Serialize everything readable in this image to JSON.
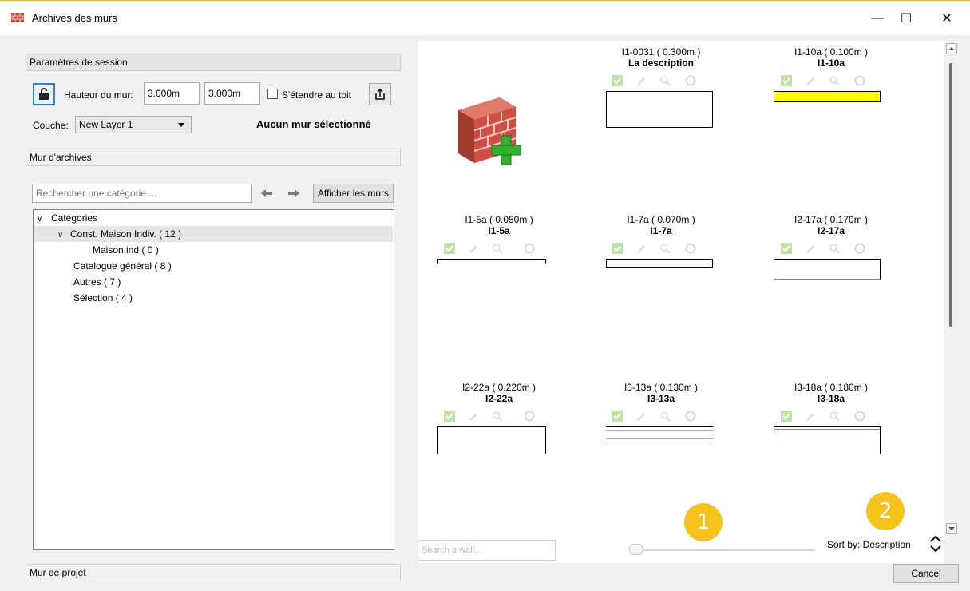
{
  "window": {
    "title": "Archives des murs",
    "minimize": "—",
    "maximize": "☐",
    "close": "✕"
  },
  "session": {
    "header": "Paramètres de session",
    "wall_height_label": "Hauteur du mur:",
    "height1": "3.000m",
    "height2": "3.000m",
    "extend_roof_label": "S'étendre au toit",
    "layer_label": "Couche:",
    "layer_value": "New Layer 1",
    "no_selection": "Aucun mur sélectionné"
  },
  "archive": {
    "header": "Mur d'archives",
    "search_placeholder": "Rechercher une catégorie ...",
    "show_walls": "Afficher les murs",
    "tree": {
      "root": "Catégories",
      "items": [
        {
          "label": "Const. Maison Indiv. ( 12 )"
        },
        {
          "label": "Maison ind ( 0 )"
        },
        {
          "label": "Catalogue général ( 8 )"
        },
        {
          "label": "Autres ( 7 )"
        },
        {
          "label": "Sélection ( 4 )"
        }
      ]
    }
  },
  "project": {
    "header": "Mur de projet"
  },
  "walls": [
    {
      "title": "I1-0031 ( 0.300m )",
      "sub": "La description",
      "preview": "empty-box"
    },
    {
      "title": "I1-10a ( 0.100m )",
      "sub": "I1-10a",
      "preview": "yellow"
    },
    {
      "title": "I1-5a ( 0.050m )",
      "sub": "I1-5a",
      "preview": "thin"
    },
    {
      "title": "I1-7a ( 0.070m )",
      "sub": "I1-7a",
      "preview": "double"
    },
    {
      "title": "I2-17a ( 0.170m )",
      "sub": "I2-17a",
      "preview": "brown-box"
    },
    {
      "title": "I2-22a ( 0.220m )",
      "sub": "I2-22a",
      "preview": "open-box"
    },
    {
      "title": "I3-13a ( 0.130m )",
      "sub": "I3-13a",
      "preview": "orange-lines"
    },
    {
      "title": "I3-18a ( 0.180m )",
      "sub": "I3-18a",
      "preview": "brown-lines"
    }
  ],
  "bottom": {
    "search_wall_placeholder": "Search a wall...",
    "sort_label": "Sort by: Description",
    "cancel": "Cancel",
    "badge1": "1",
    "badge2": "2",
    "size_slider_value": 0
  },
  "colors": {
    "accent": "#2f7fd6",
    "badge": "#f6c21c",
    "wall_yellow": "#ffff00"
  }
}
